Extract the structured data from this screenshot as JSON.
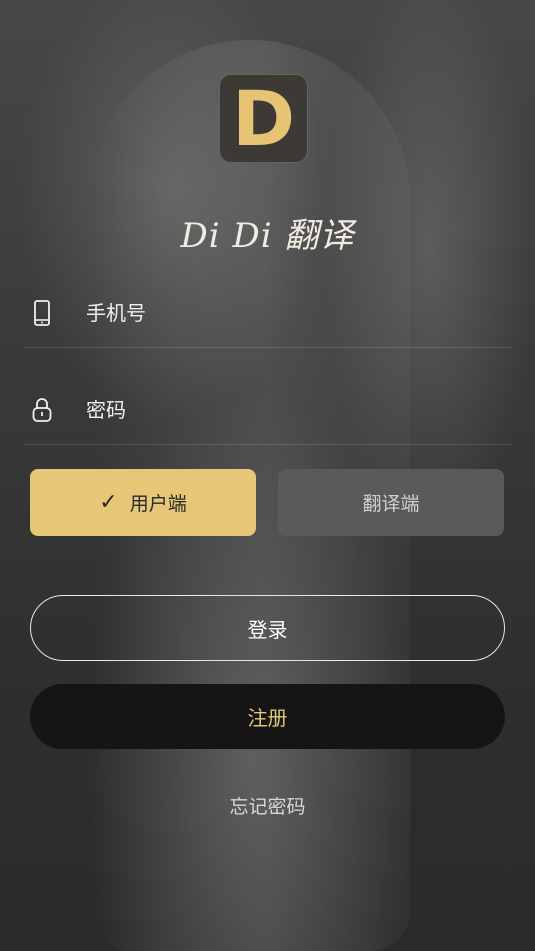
{
  "app": {
    "logo_letter": "D",
    "title": "Di Di 翻译"
  },
  "form": {
    "phone_placeholder": "手机号",
    "password_placeholder": "密码"
  },
  "roles": {
    "user_label": "用户端",
    "translator_label": "翻译端",
    "selected": "user"
  },
  "actions": {
    "login_label": "登录",
    "register_label": "注册",
    "forgot_label": "忘记密码"
  },
  "colors": {
    "accent": "#e6c677",
    "dark_button": "#151515",
    "unselected_role": "#5a5a5a"
  },
  "icons": {
    "phone": "phone-icon",
    "password": "lock-icon",
    "check": "check-icon"
  }
}
